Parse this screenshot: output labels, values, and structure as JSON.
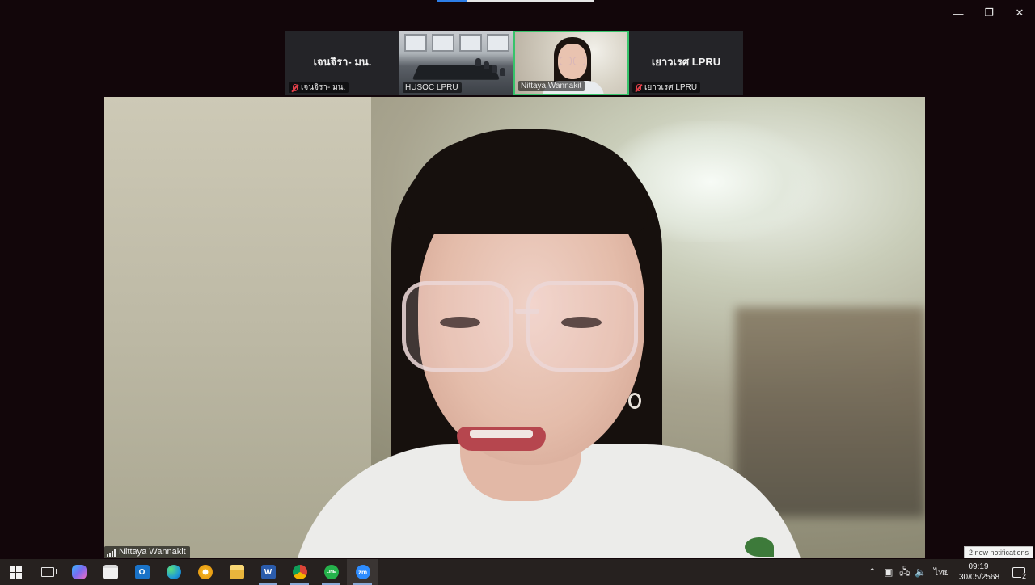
{
  "window": {
    "minimize_glyph": "—",
    "restore_glyph": "❐",
    "close_glyph": "✕"
  },
  "thumbnails": [
    {
      "kind": "name",
      "big_name": "เจนจิรา- มน.",
      "tag": "เจนจิรา- มน.",
      "muted": true
    },
    {
      "kind": "video-room",
      "tag": "HUSOC LPRU",
      "muted": false
    },
    {
      "kind": "video-self",
      "tag": "Nittaya Wannakit",
      "muted": false,
      "highlighted": true
    },
    {
      "kind": "name",
      "big_name": "เยาวเรศ LPRU",
      "tag": "เยาวเรศ LPRU",
      "muted": true
    }
  ],
  "speaker": {
    "name": "Nittaya Wannakit"
  },
  "taskbar": {
    "apps": [
      {
        "name": "start-button",
        "icon": "windows-logo-icon"
      },
      {
        "name": "task-view",
        "icon": "task-view-icon"
      },
      {
        "name": "copilot",
        "icon": "copilot-icon",
        "color": "#7a6cf0"
      },
      {
        "name": "microsoft-store",
        "icon": "store-icon",
        "color": "#f0f0f0"
      },
      {
        "name": "outlook",
        "icon": "outlook-icon",
        "color": "#1a73c8",
        "label": "O"
      },
      {
        "name": "edge",
        "icon": "edge-icon",
        "color": "#1f9bd6"
      },
      {
        "name": "chrome-canary",
        "icon": "chrome-canary-icon",
        "color": "#f2b01e"
      },
      {
        "name": "file-explorer",
        "icon": "folder-icon",
        "color": "#f0c54a"
      },
      {
        "name": "word",
        "icon": "word-icon",
        "color": "#2b5cab",
        "label": "W"
      },
      {
        "name": "chrome",
        "icon": "chrome-icon",
        "color": "#db4437"
      },
      {
        "name": "line",
        "icon": "line-icon",
        "color": "#25b24b",
        "label": "LINE"
      },
      {
        "name": "zoom",
        "icon": "zoom-icon",
        "color": "#2d8cff",
        "label": "zm"
      }
    ],
    "tray": {
      "language": "ไทย",
      "time": "09:19",
      "date": "30/05/2568",
      "notification_count": "2",
      "toast": "2 new notifications"
    }
  }
}
